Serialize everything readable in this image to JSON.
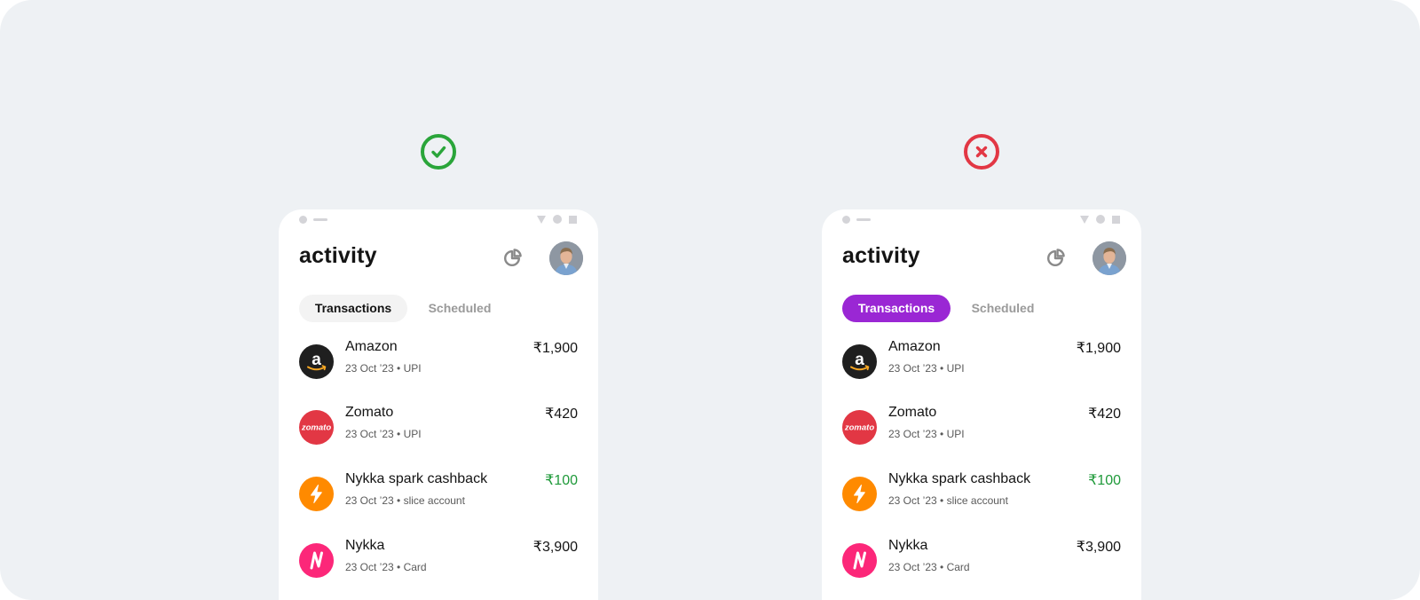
{
  "colors": {
    "good": "#2aa53a",
    "bad": "#e23744",
    "accent": "#9a27d4",
    "credit": "#1f9a3a"
  },
  "variants": [
    {
      "verdict": "check-icon",
      "title": "activity",
      "tabs": [
        "Transactions",
        "Scheduled"
      ],
      "transactions": [
        {
          "icon": "amazon-logo-icon",
          "name": "Amazon",
          "meta": "23 Oct ’23 • UPI",
          "amount": "₹1,900"
        },
        {
          "icon": "zomato-logo-icon",
          "name": "Zomato",
          "meta": "23 Oct ’23 • UPI",
          "amount": "₹420"
        },
        {
          "icon": "lightning-icon",
          "name": "Nykka spark cashback",
          "meta": "23 Oct ’23 • slice account",
          "amount": "₹100"
        },
        {
          "icon": "nykaa-logo-icon",
          "name": "Nykka",
          "meta": "23 Oct ’23 • Card",
          "amount": "₹3,900"
        }
      ]
    },
    {
      "verdict": "cross-icon",
      "title": "activity",
      "tabs": [
        "Transactions",
        "Scheduled"
      ],
      "transactions": [
        {
          "icon": "amazon-logo-icon",
          "name": "Amazon",
          "meta": "23 Oct ’23 • UPI",
          "amount": "₹1,900"
        },
        {
          "icon": "zomato-logo-icon",
          "name": "Zomato",
          "meta": "23 Oct ’23 • UPI",
          "amount": "₹420"
        },
        {
          "icon": "lightning-icon",
          "name": "Nykka spark cashback",
          "meta": "23 Oct ’23 • slice account",
          "amount": "₹100"
        },
        {
          "icon": "nykaa-logo-icon",
          "name": "Nykka",
          "meta": "23 Oct ’23 • Card",
          "amount": "₹3,900"
        }
      ]
    }
  ],
  "logo_text": {
    "amazon": "a",
    "zomato": "zomato"
  }
}
